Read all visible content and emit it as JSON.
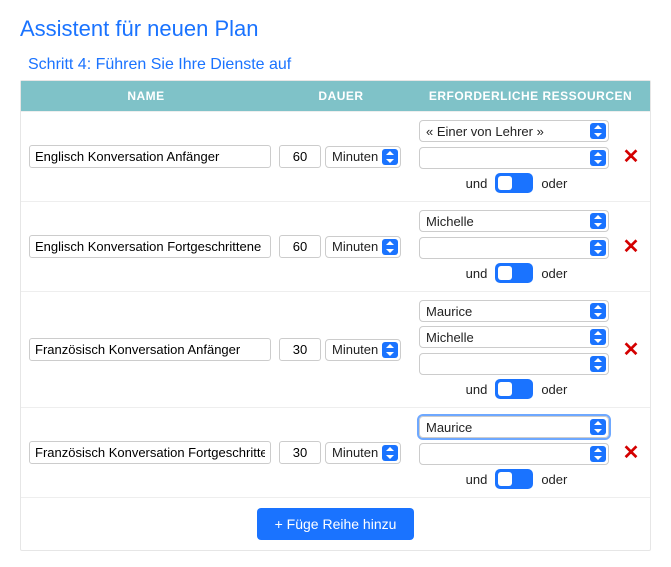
{
  "page_title": "Assistent für neuen Plan",
  "step_title": "Schritt 4: Führen Sie Ihre Dienste auf",
  "columns": {
    "name": "NAME",
    "duration": "DAUER",
    "resources": "ERFORDERLICHE RESSOURCEN"
  },
  "duration_unit": "Minuten",
  "andor": {
    "and": "und",
    "or": "oder"
  },
  "add_row_label": "+ Füge Reihe hinzu",
  "rows": [
    {
      "name": "Englisch Konversation Anfänger",
      "duration": "60",
      "resources": [
        "« Einer von Lehrer »",
        ""
      ]
    },
    {
      "name": "Englisch Konversation Fortgeschrittene",
      "duration": "60",
      "resources": [
        "Michelle",
        ""
      ]
    },
    {
      "name": "Französisch Konversation Anfänger",
      "duration": "30",
      "resources": [
        "Maurice",
        "Michelle",
        ""
      ]
    },
    {
      "name": "Französisch Konversation Fortgeschritte",
      "duration": "30",
      "resources": [
        "Maurice",
        ""
      ],
      "focus_first": true
    }
  ]
}
